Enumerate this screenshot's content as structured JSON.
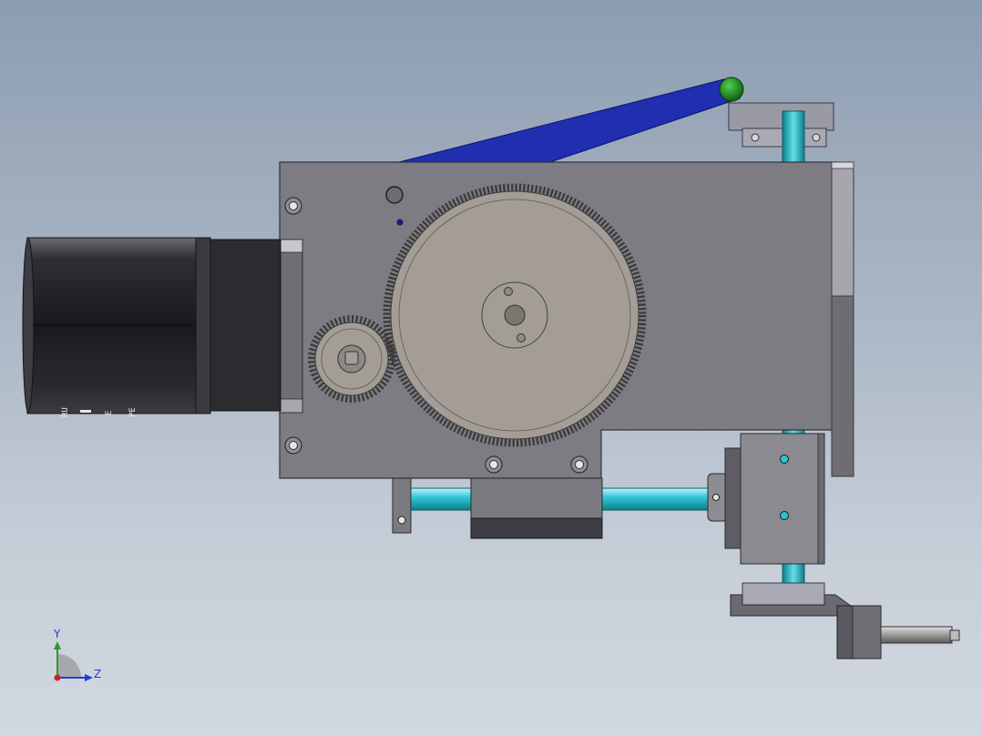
{
  "viewport": {
    "background_top": "#8d9db1",
    "background_bottom": "#d2d8e0"
  },
  "triad": {
    "y_label": "Y",
    "z_label": "Z",
    "y_color": "#2a9a2a",
    "z_color": "#1f3fd0",
    "x_color": "#d02020"
  },
  "parts": {
    "motor_marks": [
      "RU",
      "E",
      "PE"
    ],
    "linkage_arm_color": "#1f2fb0",
    "pivot_knob_color": "#1e8a1e",
    "shaft_color": "#2fc8d6",
    "plate_color": "#7c7c82",
    "gear_color": "#a39d96",
    "motor_body_color": "#2a2a2e"
  }
}
